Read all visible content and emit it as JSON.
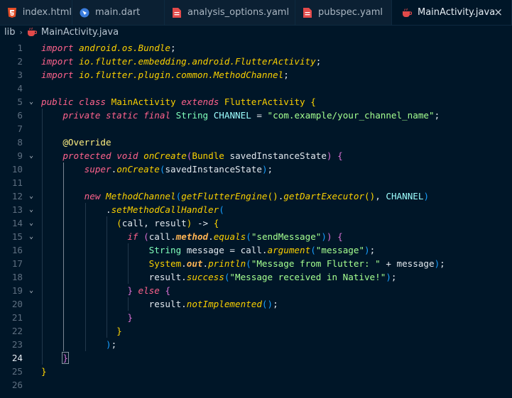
{
  "tabs": [
    {
      "label": "index.html",
      "icon": "html5-icon",
      "color": "#e44d26"
    },
    {
      "label": "main.dart",
      "icon": "dart-icon",
      "color": "#3b7ddd"
    },
    {
      "label": "analysis_options.yaml",
      "icon": "yaml-icon",
      "color": "#e24a4a"
    },
    {
      "label": "pubspec.yaml",
      "icon": "yaml-icon",
      "color": "#e24a4a"
    },
    {
      "label": "MainActivity.java",
      "icon": "java-icon",
      "color": "#e24a4a",
      "active": true
    }
  ],
  "close_glyph": "×",
  "breadcrumb": {
    "folder": "lib",
    "separator": "›",
    "file": "MainActivity.java"
  },
  "editor": {
    "current_line": 24,
    "line_numbers": [
      "1",
      "2",
      "3",
      "4",
      "5",
      "6",
      "7",
      "8",
      "9",
      "10",
      "11",
      "12",
      "13",
      "14",
      "15",
      "16",
      "17",
      "18",
      "19",
      "20",
      "21",
      "22",
      "23",
      "24",
      "25",
      "26"
    ],
    "lines": [
      "import android.os.Bundle;",
      "import io.flutter.embedding.android.FlutterActivity;",
      "import io.flutter.plugin.common.MethodChannel;",
      "",
      "public class MainActivity extends FlutterActivity {",
      "    private static final String CHANNEL = \"com.example/your_channel_name\";",
      "",
      "    @Override",
      "    protected void onCreate(Bundle savedInstanceState) {",
      "        super.onCreate(savedInstanceState);",
      "",
      "        new MethodChannel(getFlutterEngine().getDartExecutor(), CHANNEL)",
      "            .setMethodCallHandler(",
      "              (call, result) -> {",
      "                if (call.method.equals(\"sendMessage\")) {",
      "                    String message = call.argument(\"message\");",
      "                    System.out.println(\"Message from Flutter: \" + message);",
      "                    result.success(\"Message received in Native!\");",
      "                } else {",
      "                    result.notImplemented();",
      "                }",
      "              }",
      "            );",
      "    }",
      "}",
      ""
    ],
    "foldable_lines": [
      5,
      9,
      12,
      13,
      14,
      15,
      19
    ],
    "fold_glyph": "⌄"
  },
  "colors": {
    "background": "#001628",
    "tabbar": "#0b2033",
    "keyword": "#ff628c",
    "string": "#a5ff90",
    "class": "#fad000"
  }
}
